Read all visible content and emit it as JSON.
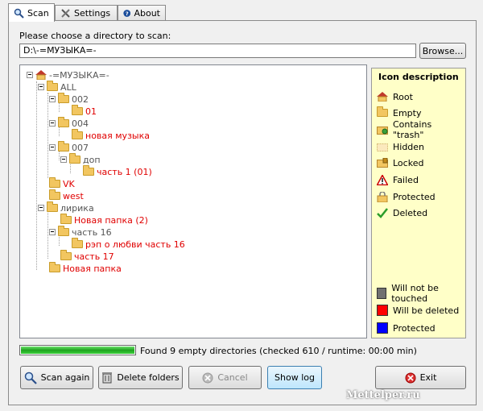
{
  "tabs": [
    {
      "label": "Scan",
      "icon": "magnifier-icon"
    },
    {
      "label": "Settings",
      "icon": "tools-icon"
    },
    {
      "label": "About",
      "icon": "help-icon"
    }
  ],
  "scan": {
    "prompt": "Please choose a directory to scan:",
    "path": "D:\\-=МУЗЫКА=-",
    "browse_label": "Browse..."
  },
  "tree": [
    {
      "label": "-=МУЗЫКА=-",
      "color": "gray",
      "icon": "root-icon"
    },
    {
      "label": "ALL",
      "color": "gray"
    },
    {
      "label": "002",
      "color": "gray"
    },
    {
      "label": "01",
      "color": "red"
    },
    {
      "label": "004",
      "color": "gray"
    },
    {
      "label": "новая музыка",
      "color": "red"
    },
    {
      "label": "007",
      "color": "gray"
    },
    {
      "label": "доп",
      "color": "gray"
    },
    {
      "label": "часть 1 (01)",
      "color": "red"
    },
    {
      "label": "VK",
      "color": "red"
    },
    {
      "label": "west",
      "color": "red"
    },
    {
      "label": "лирика",
      "color": "gray"
    },
    {
      "label": "Новая папка (2)",
      "color": "red"
    },
    {
      "label": "часть 16",
      "color": "gray"
    },
    {
      "label": "рэп о любви часть 16",
      "color": "red"
    },
    {
      "label": "часть 17",
      "color": "red"
    },
    {
      "label": "Новая папка",
      "color": "red"
    }
  ],
  "icon_description": {
    "title": "Icon description",
    "items": [
      {
        "label": "Root",
        "icon": "root-icon"
      },
      {
        "label": "Empty",
        "icon": "empty-folder-icon"
      },
      {
        "label": "Contains \"trash\"",
        "icon": "trash-folder-icon"
      },
      {
        "label": "Hidden",
        "icon": "hidden-folder-icon"
      },
      {
        "label": "Locked",
        "icon": "locked-folder-icon"
      },
      {
        "label": "Failed",
        "icon": "warning-icon"
      },
      {
        "label": "Protected",
        "icon": "protected-folder-icon"
      },
      {
        "label": "Deleted",
        "icon": "checkmark-icon"
      }
    ],
    "legend": [
      {
        "label": "Will not be touched",
        "color": "#707070"
      },
      {
        "label": "Will be deleted",
        "color": "#ff0000"
      },
      {
        "label": "Protected",
        "color": "#0000ff"
      }
    ]
  },
  "status": {
    "progress_percent": 100,
    "text": "Found 9 empty directories (checked 610 / runtime: 00:00 min)"
  },
  "buttons": {
    "scan_again": "Scan again",
    "delete_folders": "Delete folders",
    "cancel": "Cancel",
    "show_log": "Show log",
    "exit": "Exit"
  },
  "watermark": "Mettelper.ru"
}
